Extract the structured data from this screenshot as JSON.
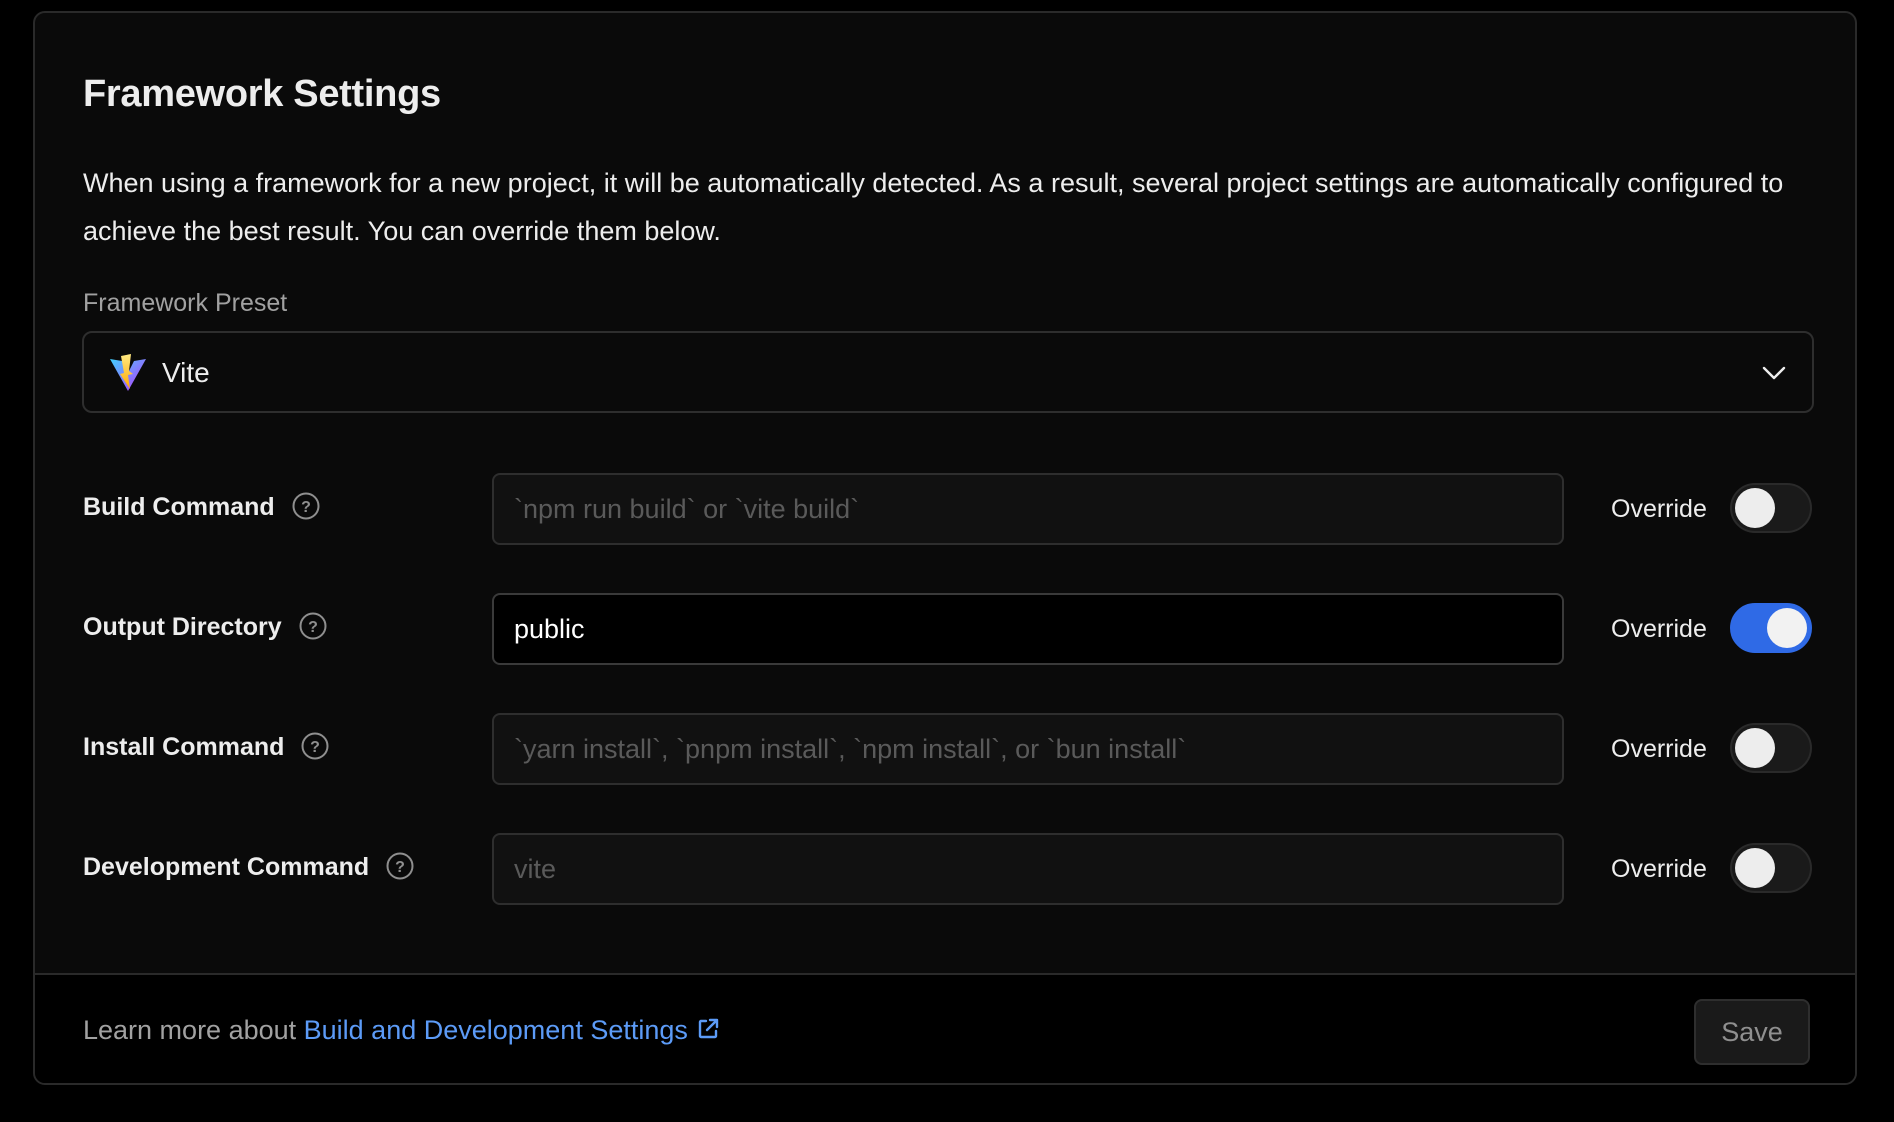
{
  "title": "Framework Settings",
  "description": "When using a framework for a new project, it will be automatically detected. As a result, several project settings are automatically configured to achieve the best result. You can override them below.",
  "preset": {
    "label": "Framework Preset",
    "selected": "Vite",
    "logo_icon": "vite-logo-icon"
  },
  "rows": [
    {
      "label": "Build Command",
      "value": "",
      "placeholder": "`npm run build` or `vite build`",
      "override_label": "Override",
      "override_on": false
    },
    {
      "label": "Output Directory",
      "value": "public",
      "placeholder": "",
      "override_label": "Override",
      "override_on": true
    },
    {
      "label": "Install Command",
      "value": "",
      "placeholder": "`yarn install`, `pnpm install`, `npm install`, or `bun install`",
      "override_label": "Override",
      "override_on": false
    },
    {
      "label": "Development Command",
      "value": "",
      "placeholder": "vite",
      "override_label": "Override",
      "override_on": false
    }
  ],
  "footer": {
    "text": "Learn more about ",
    "link_text": "Build and Development Settings",
    "save_label": "Save"
  },
  "colors": {
    "accent": "#2f6ae6",
    "link": "#5c9bf7",
    "background": "#0a0a0a"
  }
}
